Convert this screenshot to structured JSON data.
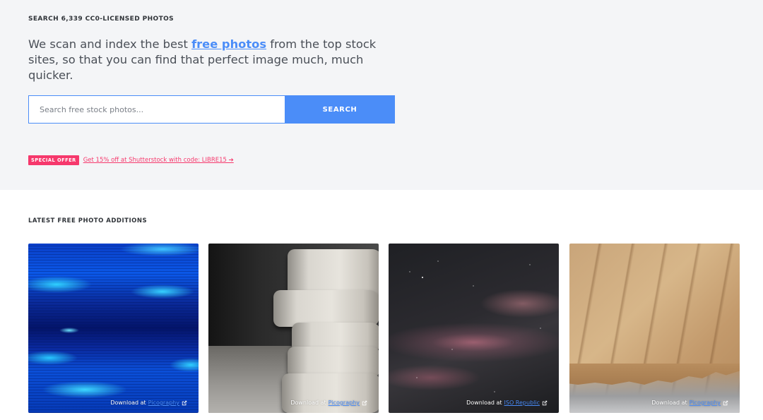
{
  "hero": {
    "eyebrow": "SEARCH 6,339 CC0-LICENSED PHOTOS",
    "intro_before": "We scan and index the best ",
    "intro_link": "free photos",
    "intro_after": " from the top stock sites, so that you can find that perfect image much, much quicker.",
    "search_placeholder": "Search free stock photos...",
    "search_button": "SEARCH",
    "offer_badge": "SPECIAL OFFER",
    "offer_link": "Get 15% off at Shutterstock with code: LIBRE15 ➔"
  },
  "latest": {
    "title": "LATEST FREE PHOTO ADDITIONS",
    "photos": [
      {
        "caption_prefix": "Download at ",
        "source": "Picography",
        "icon": "external-link-icon"
      },
      {
        "caption_prefix": "Download at ",
        "source": "Picography",
        "icon": "external-link-icon"
      },
      {
        "caption_prefix": "Download at ",
        "source": "ISO Republic",
        "icon": "external-link-icon"
      },
      {
        "caption_prefix": "Download at ",
        "source": "Picography",
        "icon": "external-link-icon"
      }
    ]
  },
  "colors": {
    "accent": "#4b8df8",
    "offer": "#f6386c",
    "hero_bg": "#f4f5f7"
  }
}
